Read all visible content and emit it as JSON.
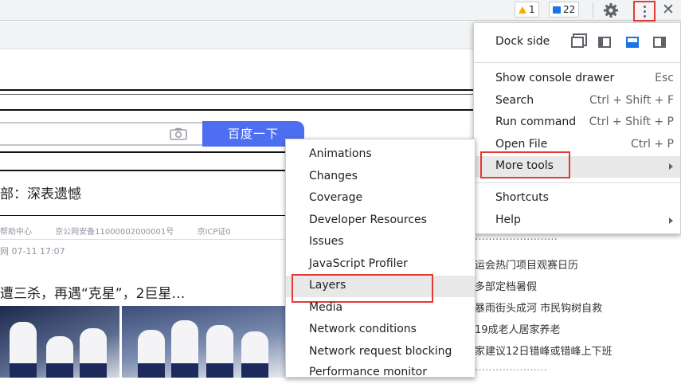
{
  "toolbar": {
    "warnings_count": "1",
    "messages_count": "22",
    "settings_icon": "gear-icon",
    "more_icon": "kebab-icon",
    "close_icon": "close-icon",
    "close_glyph": "✕"
  },
  "page": {
    "search_button": "百度一下",
    "headline": "部：深表遗憾",
    "footer_links": [
      "帮助中心",
      "京公网安备11000002000001号",
      "京ICP证0"
    ],
    "meta": "网  07-11 17:07",
    "news2": "遭三杀，再遇“克星”，2巨星…",
    "hot_list": [
      "……………………",
      "运会热门项目观赛日历",
      "多部定档暑假",
      "暴雨街头成河 市民钩树自救",
      "19成老人居家养老",
      "家建议12日错峰或错峰上下班",
      "…………………"
    ]
  },
  "menu": {
    "dock_side_label": "Dock side",
    "items": [
      {
        "label": "Show console drawer",
        "shortcut": "Esc"
      },
      {
        "label": "Search",
        "shortcut": "Ctrl + Shift + F"
      },
      {
        "label": "Run command",
        "shortcut": "Ctrl + Shift + P"
      },
      {
        "label": "Open File",
        "shortcut": "Ctrl + P"
      },
      {
        "label": "More tools",
        "shortcut": ""
      },
      {
        "label": "Shortcuts",
        "shortcut": ""
      },
      {
        "label": "Help",
        "shortcut": ""
      }
    ]
  },
  "submenu": {
    "items": [
      "Animations",
      "Changes",
      "Coverage",
      "Developer Resources",
      "Issues",
      "JavaScript Profiler",
      "Layers",
      "Media",
      "Network conditions",
      "Network request blocking",
      "Performance monitor"
    ]
  },
  "colors": {
    "highlight_border": "#e53935",
    "baidu_blue": "#4e6ef2",
    "dock_active": "#1a73e8"
  }
}
